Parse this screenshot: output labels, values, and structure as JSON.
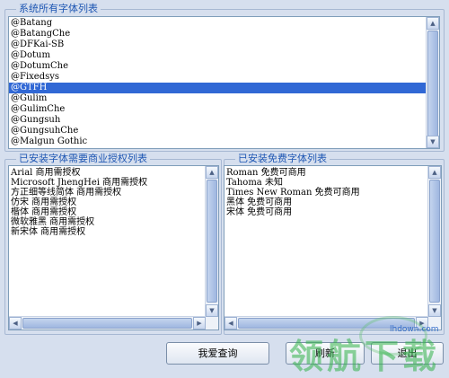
{
  "all_fonts": {
    "title": "系统所有字体列表",
    "items": [
      "@Batang",
      "@BatangChe",
      "@DFKai-SB",
      "@Dotum",
      "@DotumChe",
      "@Fixedsys",
      "@GTFH",
      "@Gulim",
      "@GulimChe",
      "@Gungsuh",
      "@GungsuhChe",
      "@Malgun Gothic"
    ],
    "selected_index": 6
  },
  "commercial_fonts": {
    "title": "已安装字体需要商业授权列表",
    "lines": [
      "Arial 商用需授权",
      "Microsoft JhengHei 商用需授权",
      "方正细等线简体 商用需授权",
      "仿宋 商用需授权",
      "楷体 商用需授权",
      "微软雅黑 商用需授权",
      "新宋体 商用需授权"
    ]
  },
  "free_fonts": {
    "title": "已安装免费字体列表",
    "lines": [
      "Roman 免费可商用",
      "Tahoma 未知",
      "Times New Roman 免费可商用",
      "黑体 免费可商用",
      "宋体 免费可商用"
    ]
  },
  "buttons": {
    "query": "我爱查询",
    "refresh": "刷新",
    "exit": "退出"
  },
  "watermark": {
    "text": "领航下载",
    "url": "lhdown.com"
  },
  "icons": {
    "scroll_up": "▲",
    "scroll_down": "▼",
    "scroll_left": "◀",
    "scroll_right": "▶"
  }
}
